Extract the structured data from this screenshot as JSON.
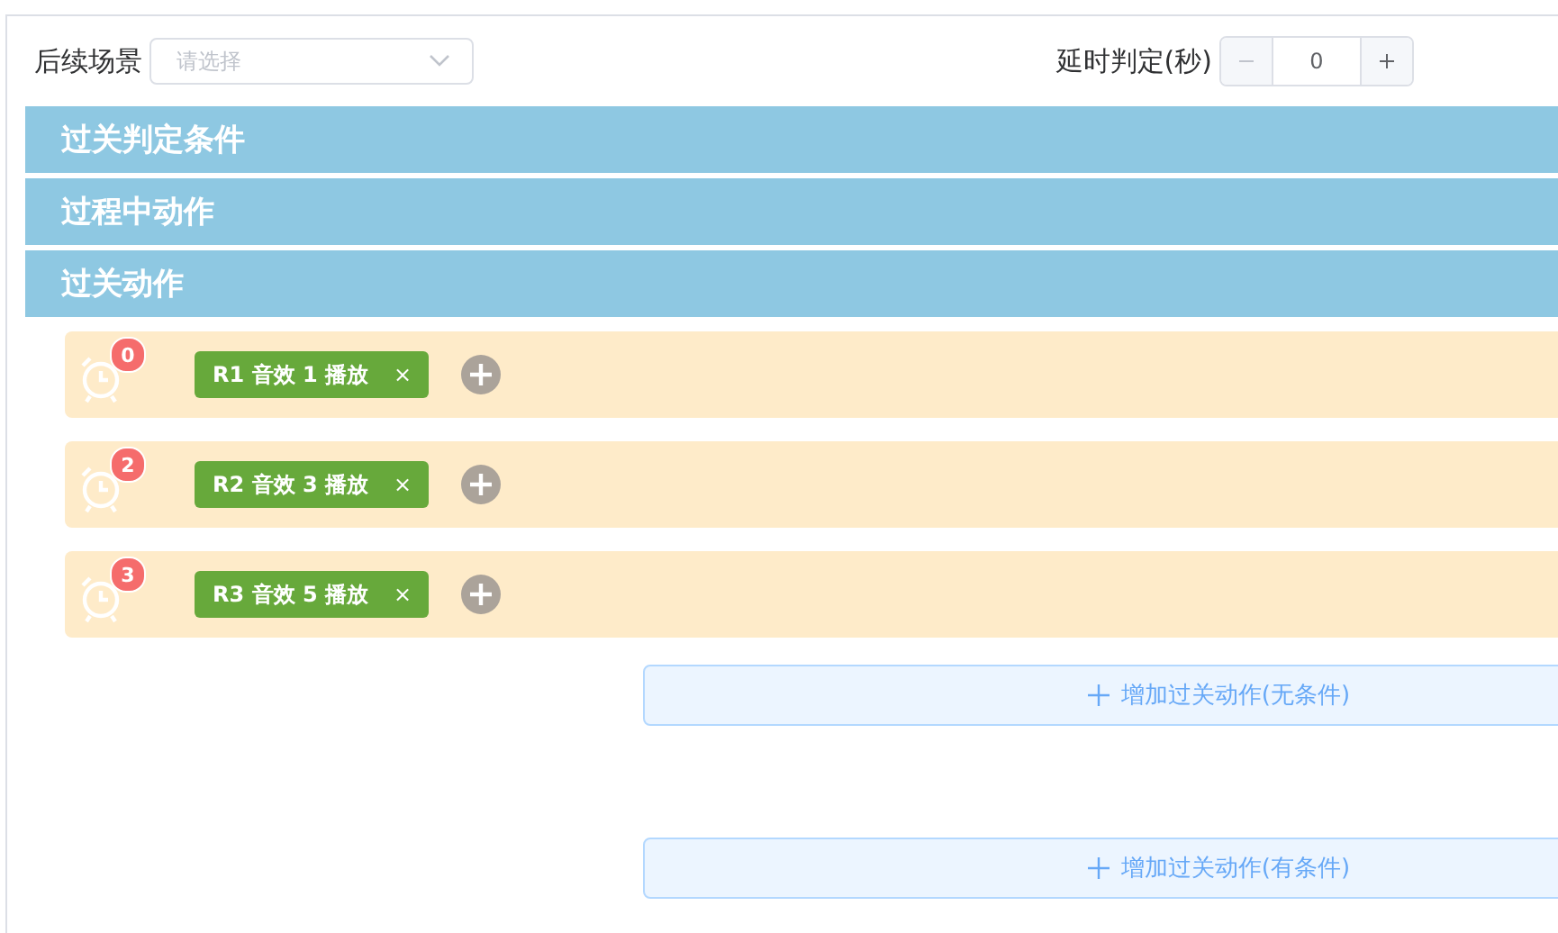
{
  "scene": {
    "label": "后续场景",
    "placeholder": "请选择"
  },
  "delay": {
    "label": "延时判定(秒)",
    "value": "0"
  },
  "sections": [
    {
      "title": "过关判定条件"
    },
    {
      "title": "过程中动作"
    },
    {
      "title": "过关动作"
    }
  ],
  "actions": [
    {
      "badge": "0",
      "tag": "R1 音效 1 播放",
      "close": "×"
    },
    {
      "badge": "2",
      "tag": "R2 音效 3 播放",
      "close": "×"
    },
    {
      "badge": "3",
      "tag": "R3 音效 5 播放",
      "close": "×"
    }
  ],
  "add_buttons": [
    {
      "label": "增加过关动作(无条件)"
    },
    {
      "label": "增加过关动作(有条件)"
    }
  ]
}
